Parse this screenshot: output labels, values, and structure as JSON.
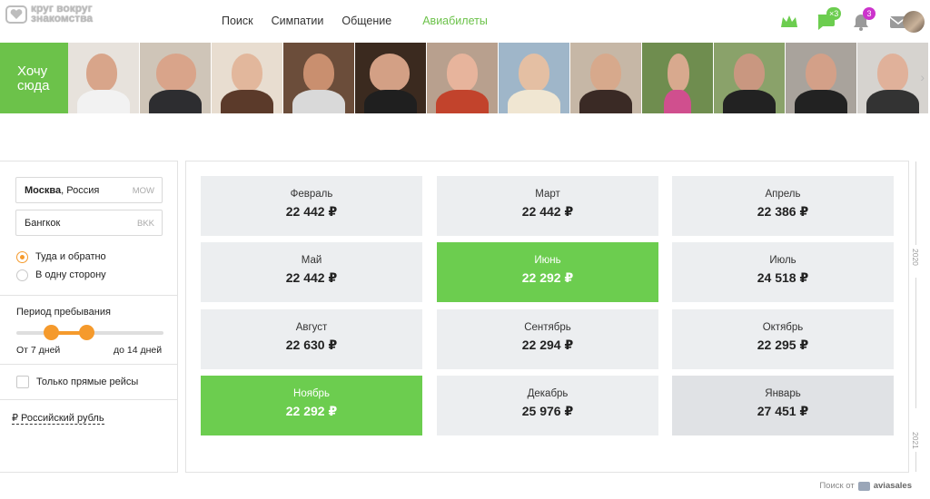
{
  "header": {
    "logo_text": "круг вокруг знакомства",
    "nav": [
      "Поиск",
      "Симпатии",
      "Общение"
    ],
    "nav_active": "Авиабилеты",
    "messages_badge": "×3",
    "notifications_badge": "3",
    "accent_color": "#6cc24a",
    "badge_color": "#cc33cc"
  },
  "strip": {
    "want_label": "Хочу сюда",
    "photos_count_visible": 12
  },
  "sidebar": {
    "from_city": "Москва",
    "from_country": ", Россия",
    "from_code": "MOW",
    "to_city": "Бангкок",
    "to_code": "BKK",
    "trip_roundtrip": "Туда и обратно",
    "trip_oneway": "В одну сторону",
    "stay_title": "Период пребывания",
    "stay_from": "От 7 дней",
    "stay_to": "до 14 дней",
    "direct_only": "Только прямые рейсы",
    "currency": "₽ Российский рубль"
  },
  "months": [
    {
      "name": "Февраль",
      "price": "22 442 ₽",
      "state": "normal"
    },
    {
      "name": "Март",
      "price": "22 442 ₽",
      "state": "normal"
    },
    {
      "name": "Апрель",
      "price": "22 386 ₽",
      "state": "normal"
    },
    {
      "name": "Май",
      "price": "22 442 ₽",
      "state": "normal"
    },
    {
      "name": "Июнь",
      "price": "22 292 ₽",
      "state": "cheapest"
    },
    {
      "name": "Июль",
      "price": "24 518 ₽",
      "state": "normal"
    },
    {
      "name": "Август",
      "price": "22 630 ₽",
      "state": "normal"
    },
    {
      "name": "Сентябрь",
      "price": "22 294 ₽",
      "state": "normal"
    },
    {
      "name": "Октябрь",
      "price": "22 295 ₽",
      "state": "normal"
    },
    {
      "name": "Ноябрь",
      "price": "22 292 ₽",
      "state": "cheapest"
    },
    {
      "name": "Декабрь",
      "price": "25 976 ₽",
      "state": "normal"
    },
    {
      "name": "Январь",
      "price": "27 451 ₽",
      "state": "hover"
    }
  ],
  "years": [
    "2020",
    "2021"
  ],
  "footer": {
    "search_by": "Поиск от",
    "brand": "aviasales"
  }
}
